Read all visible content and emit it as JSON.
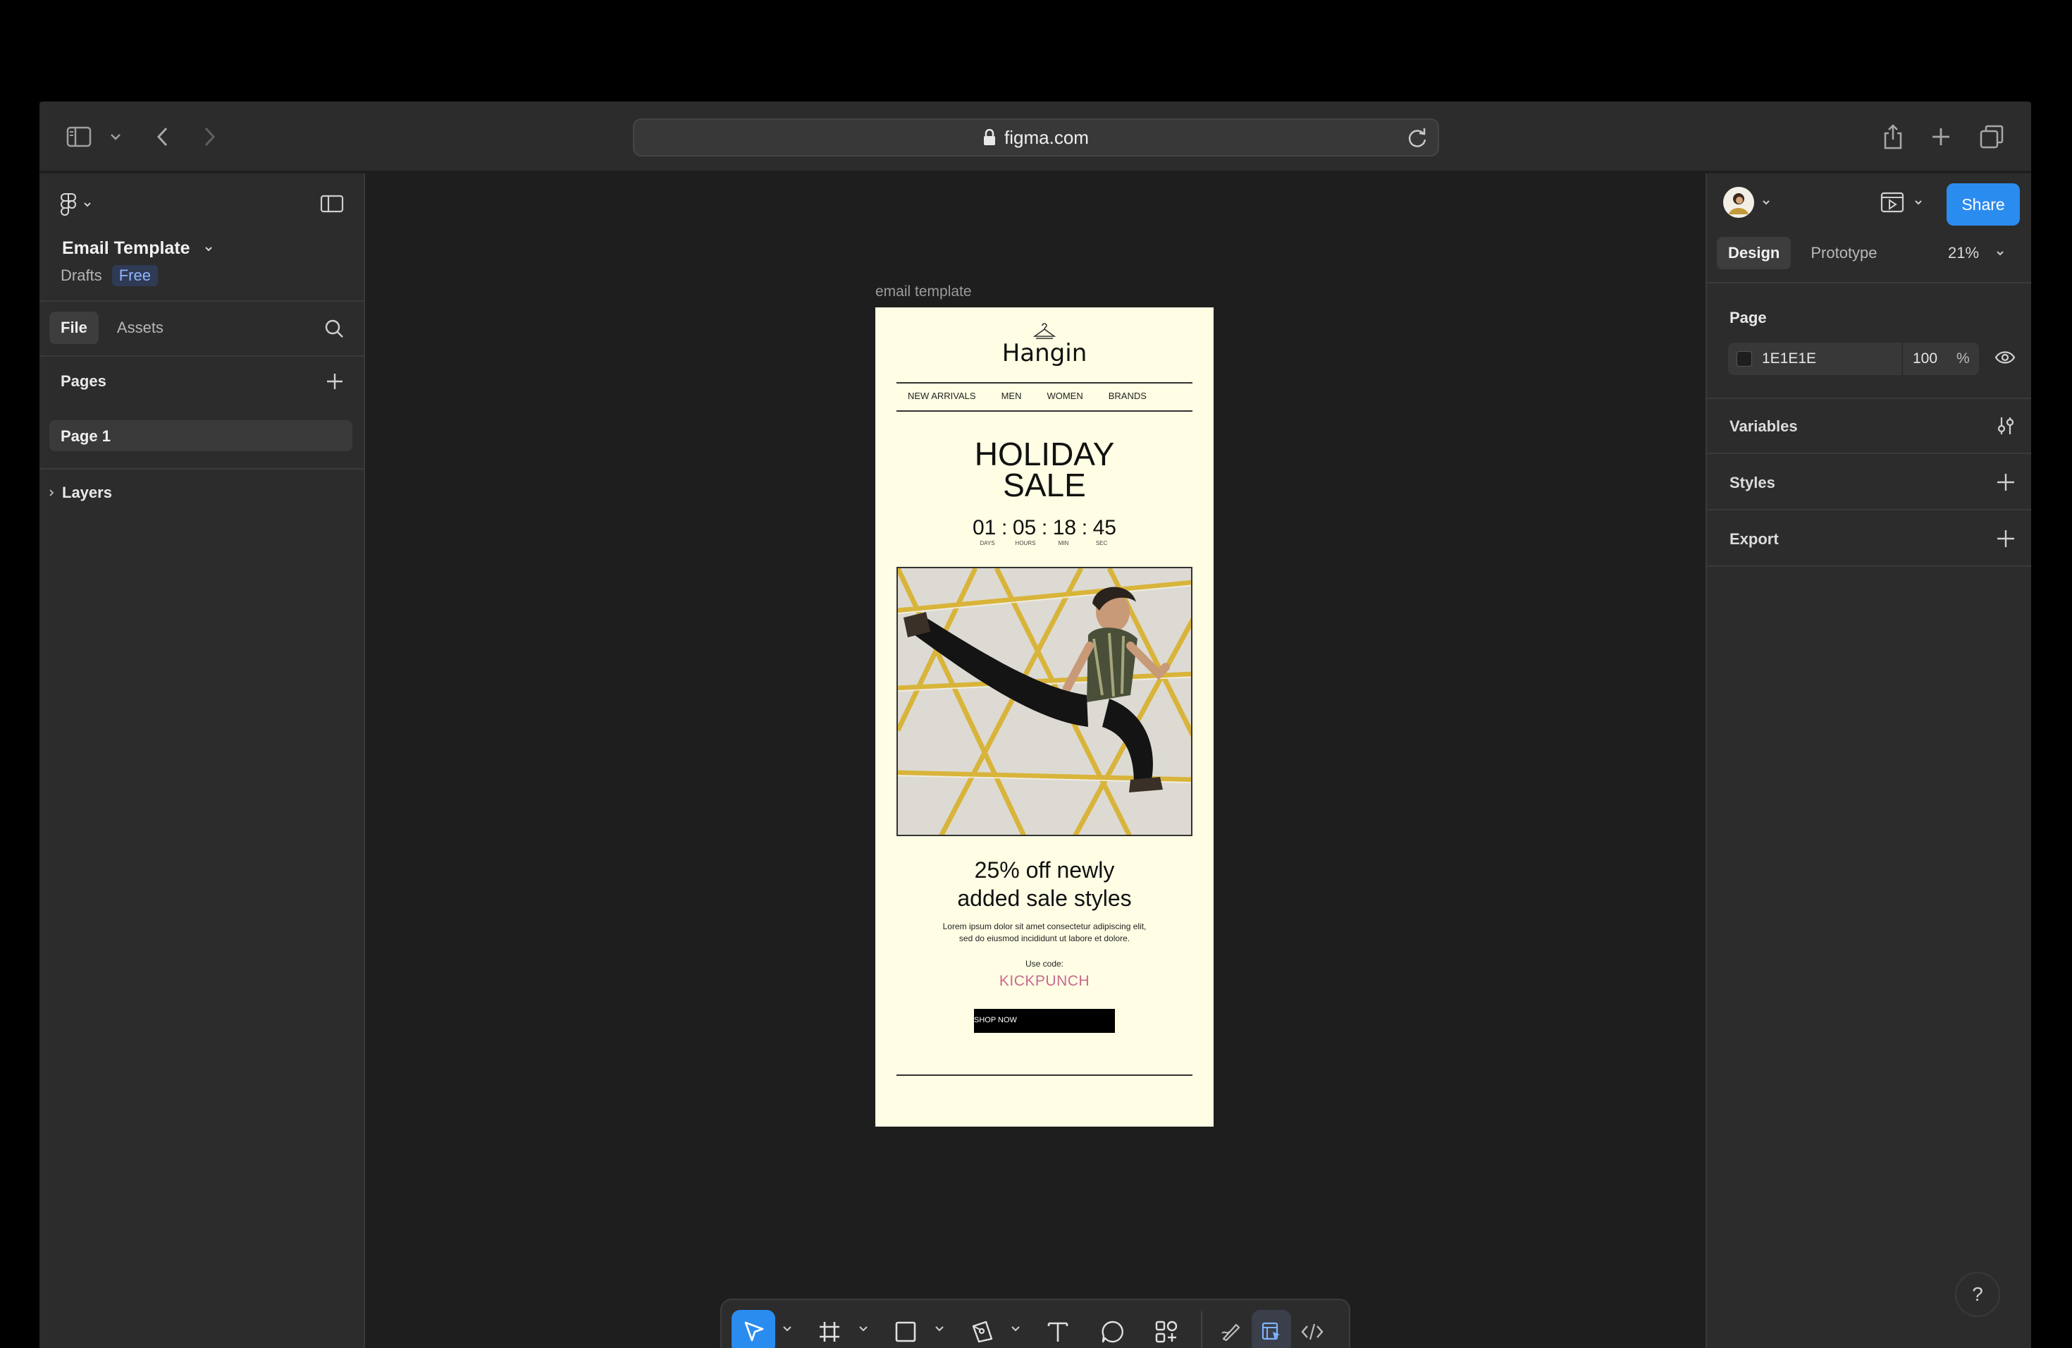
{
  "browser": {
    "url": "figma.com"
  },
  "file": {
    "title": "Email Template",
    "location": "Drafts",
    "plan_badge": "Free"
  },
  "left_panel": {
    "tabs": [
      {
        "label": "File",
        "active": true
      },
      {
        "label": "Assets",
        "active": false
      }
    ],
    "pages_header": "Pages",
    "pages": [
      {
        "label": "Page 1",
        "selected": true
      }
    ],
    "layers_header": "Layers"
  },
  "right_panel": {
    "share_label": "Share",
    "tabs": [
      {
        "label": "Design",
        "active": true
      },
      {
        "label": "Prototype",
        "active": false
      }
    ],
    "zoom": "21%",
    "page_section": "Page",
    "page_color_hex": "1E1E1E",
    "page_opacity": "100",
    "opacity_unit": "%",
    "sections": [
      "Variables",
      "Styles",
      "Export"
    ]
  },
  "canvas": {
    "frame_label": "email template",
    "email": {
      "brand": "Hangin",
      "nav": [
        "NEW ARRIVALS",
        "MEN",
        "WOMEN",
        "BRANDS"
      ],
      "title_line1": "HOLIDAY",
      "title_line2": "SALE",
      "countdown": {
        "days": "01",
        "hours": "05",
        "min": "18",
        "sec": "45",
        "sep": ":",
        "labels": [
          "DAYS",
          "HOURS",
          "MIN",
          "SEC"
        ]
      },
      "offer_line1": "25% off newly",
      "offer_line2": "added sale styles",
      "body_line1": "Lorem ipsum dolor sit amet consectetur adipiscing elit,",
      "body_line2": "sed do eiusmod incididunt ut labore et dolore.",
      "use_code_label": "Use code:",
      "promo_code": "KICKPUNCH",
      "cta": "SHOP NOW"
    }
  },
  "help_label": "?",
  "colors": {
    "accent": "#2b8cf0",
    "email_bg": "#fffee4",
    "promo": "#c8698f",
    "canvas_bg": "#1e1e1e"
  },
  "icons": {
    "browser": [
      "sidebar-icon",
      "chevron-down-icon",
      "back-icon",
      "forward-icon",
      "lock-icon",
      "reload-icon",
      "share-icon",
      "plus-icon",
      "tabs-icon"
    ],
    "toolbar": [
      "move-icon",
      "frame-icon",
      "rectangle-icon",
      "pen-icon",
      "text-icon",
      "comment-icon",
      "actions-icon",
      "draw-icon",
      "dev-mode-icon",
      "code-icon"
    ]
  }
}
